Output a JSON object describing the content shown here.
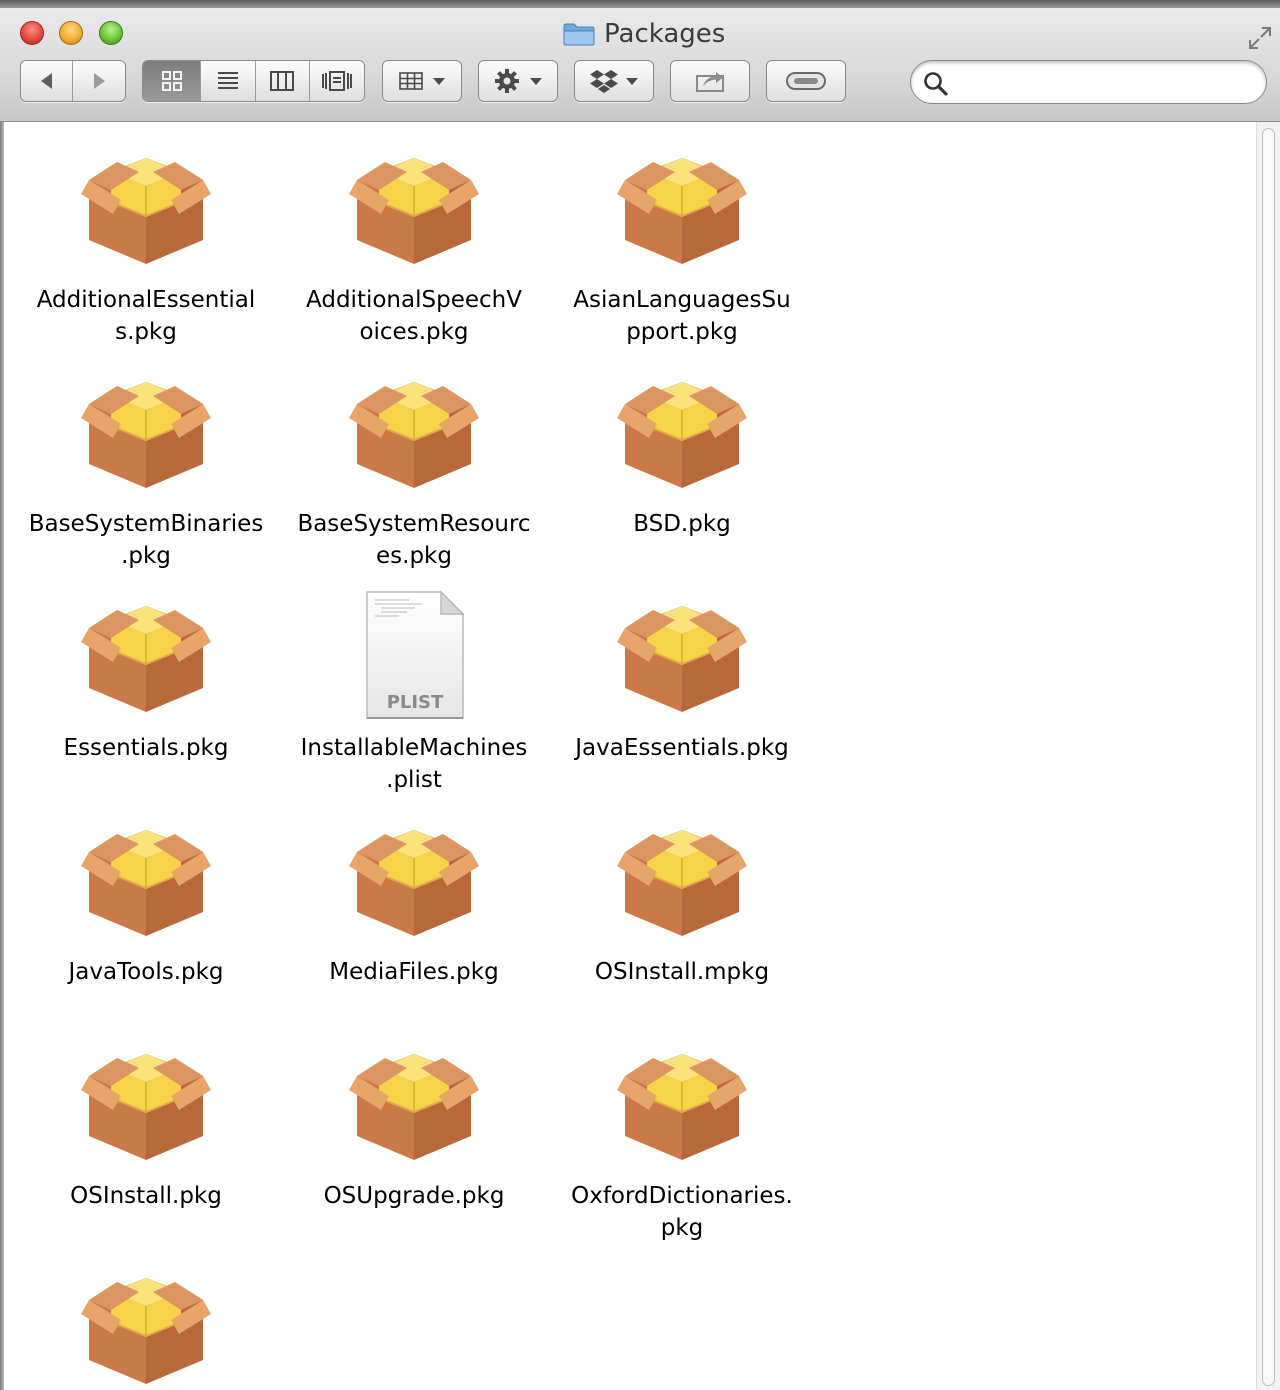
{
  "window": {
    "title": "Packages",
    "folder_icon": "folder-icon"
  },
  "toolbar": {
    "back_icon": "back-arrow-icon",
    "forward_icon": "forward-arrow-icon",
    "view_modes": [
      "icon-view-icon",
      "list-view-icon",
      "column-view-icon",
      "cover-flow-icon"
    ],
    "active_view": "icon-view",
    "arrange_icon": "arrange-grid-icon",
    "action_icon": "gear-icon",
    "dropbox_icon": "dropbox-icon",
    "share_icon": "share-icon",
    "tags_icon": "tag-toggle-icon",
    "search": {
      "value": "",
      "placeholder": ""
    }
  },
  "files": [
    {
      "name_lines": [
        "AdditionalEssential",
        "s.pkg"
      ],
      "type": "package"
    },
    {
      "name_lines": [
        "AdditionalSpeechV",
        "oices.pkg"
      ],
      "type": "package"
    },
    {
      "name_lines": [
        "AsianLanguagesSu",
        "pport.pkg"
      ],
      "type": "package"
    },
    {
      "name_lines": [
        "BaseSystemBinaries",
        ".pkg"
      ],
      "type": "package"
    },
    {
      "name_lines": [
        "BaseSystemResourc",
        "es.pkg"
      ],
      "type": "package"
    },
    {
      "name_lines": [
        "BSD.pkg"
      ],
      "type": "package"
    },
    {
      "name_lines": [
        "Essentials.pkg"
      ],
      "type": "package"
    },
    {
      "name_lines": [
        "InstallableMachines",
        ".plist"
      ],
      "type": "plist",
      "badge": "PLIST"
    },
    {
      "name_lines": [
        "JavaEssentials.pkg"
      ],
      "type": "package"
    },
    {
      "name_lines": [
        "JavaTools.pkg"
      ],
      "type": "package"
    },
    {
      "name_lines": [
        "MediaFiles.pkg"
      ],
      "type": "package"
    },
    {
      "name_lines": [
        "OSInstall.mpkg"
      ],
      "type": "package"
    },
    {
      "name_lines": [
        "OSInstall.pkg"
      ],
      "type": "package"
    },
    {
      "name_lines": [
        "OSUpgrade.pkg"
      ],
      "type": "package"
    },
    {
      "name_lines": [
        "OxfordDictionaries.",
        "pkg"
      ],
      "type": "package"
    },
    {
      "name_lines": [],
      "type": "package"
    }
  ],
  "colors": {
    "box_brown": "#b8683a",
    "box_light": "#e7a46b",
    "box_yellow": "#f7d34a",
    "close": "#e0443a",
    "minimize": "#f0a92a",
    "zoom": "#62c233"
  }
}
